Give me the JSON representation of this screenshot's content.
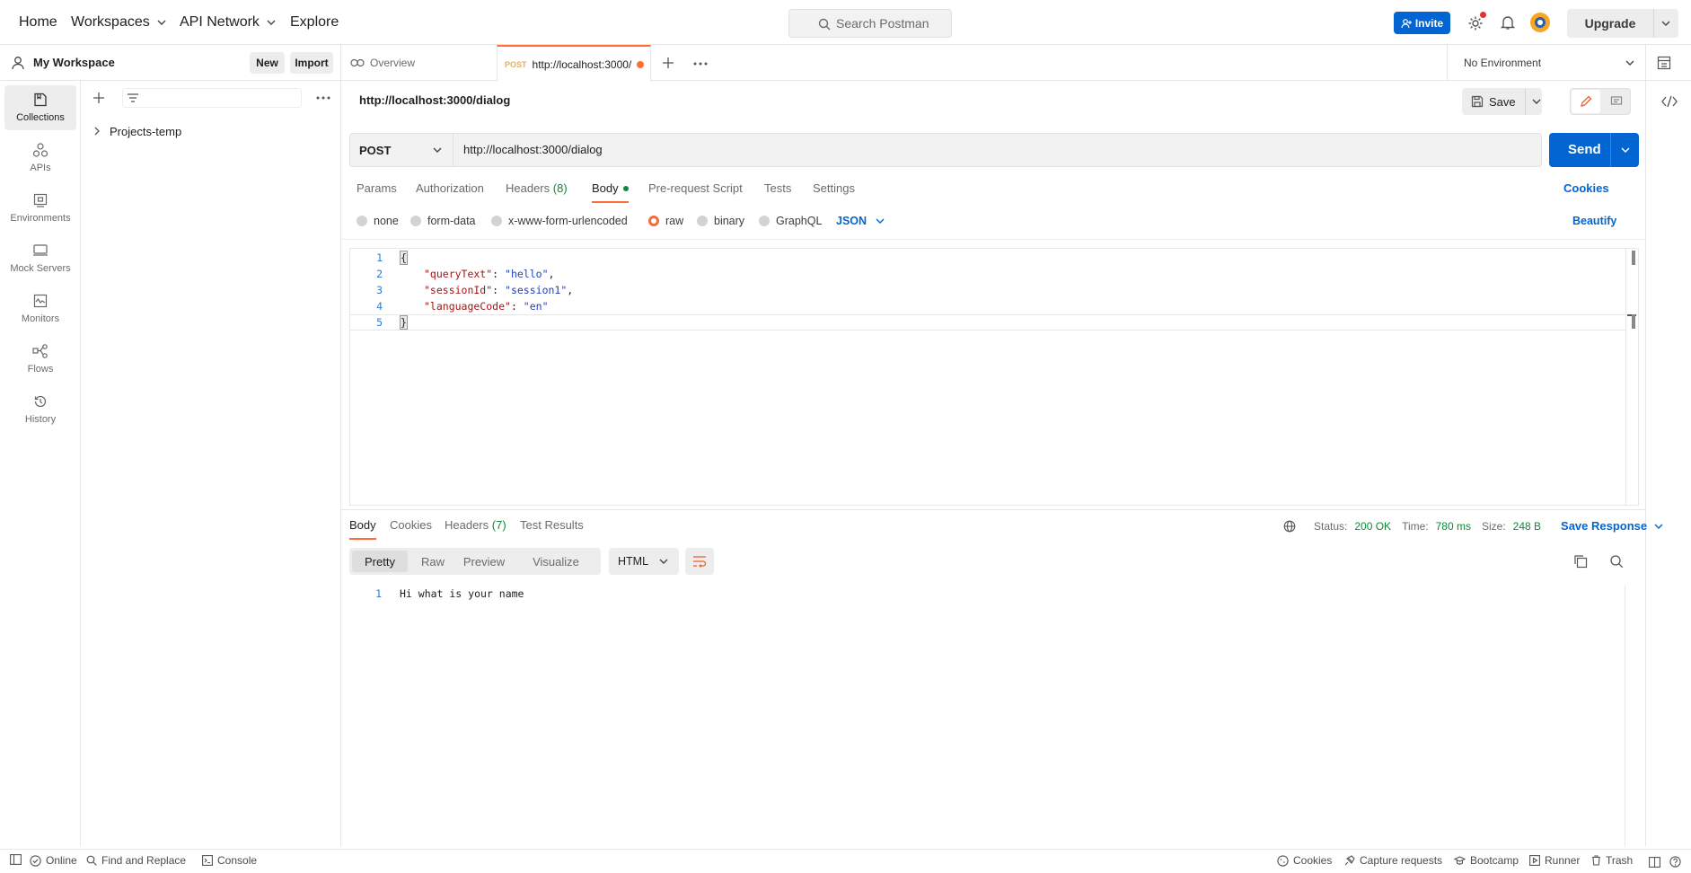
{
  "topbar": {
    "nav": [
      "Home",
      "Workspaces",
      "API Network",
      "Explore"
    ],
    "search_placeholder": "Search Postman",
    "invite_label": "Invite",
    "upgrade_label": "Upgrade"
  },
  "workspace": {
    "name": "My Workspace",
    "new_label": "New",
    "import_label": "Import"
  },
  "rail": [
    {
      "label": "Collections",
      "icon": "collections-icon"
    },
    {
      "label": "APIs",
      "icon": "apis-icon"
    },
    {
      "label": "Environments",
      "icon": "environments-icon"
    },
    {
      "label": "Mock Servers",
      "icon": "mock-servers-icon"
    },
    {
      "label": "Monitors",
      "icon": "monitors-icon"
    },
    {
      "label": "Flows",
      "icon": "flows-icon"
    },
    {
      "label": "History",
      "icon": "history-icon"
    }
  ],
  "sidebar": {
    "collections": [
      {
        "name": "Projects-temp"
      }
    ]
  },
  "tabs": {
    "overview_label": "Overview",
    "active_method": "POST",
    "active_url": "http://localhost:3000/",
    "environment": "No Environment"
  },
  "request": {
    "title": "http://localhost:3000/dialog",
    "save_label": "Save",
    "method": "POST",
    "url": "http://localhost:3000/dialog",
    "send_label": "Send",
    "subtabs": {
      "params": "Params",
      "authorization": "Authorization",
      "headers": "Headers",
      "headers_count": "(8)",
      "body": "Body",
      "prerequest": "Pre-request Script",
      "tests": "Tests",
      "settings": "Settings"
    },
    "cookies_label": "Cookies",
    "body_types": [
      "none",
      "form-data",
      "x-www-form-urlencoded",
      "raw",
      "binary",
      "GraphQL"
    ],
    "selected_body_type": "raw",
    "format": "JSON",
    "beautify_label": "Beautify",
    "code_lines": [
      {
        "n": "1",
        "text": "{"
      },
      {
        "n": "2",
        "key": "\"queryText\"",
        "val": "\"hello\"",
        "comma": ","
      },
      {
        "n": "3",
        "key": "\"sessionId\"",
        "val": "\"session1\"",
        "comma": ","
      },
      {
        "n": "4",
        "key": "\"languageCode\"",
        "val": "\"en\"",
        "comma": ""
      },
      {
        "n": "5",
        "text": "}"
      }
    ]
  },
  "response": {
    "tabs": {
      "body": "Body",
      "cookies": "Cookies",
      "headers": "Headers",
      "headers_count": "(7)",
      "test_results": "Test Results"
    },
    "status_label": "Status:",
    "status_value": "200 OK",
    "time_label": "Time:",
    "time_value": "780 ms",
    "size_label": "Size:",
    "size_value": "248 B",
    "save_response_label": "Save Response",
    "views": [
      "Pretty",
      "Raw",
      "Preview",
      "Visualize"
    ],
    "format": "HTML",
    "lines": [
      {
        "n": "1",
        "text": "Hi what is your name"
      }
    ]
  },
  "footer": {
    "online": "Online",
    "find_replace": "Find and Replace",
    "console": "Console",
    "cookies": "Cookies",
    "capture": "Capture requests",
    "bootcamp": "Bootcamp",
    "runner": "Runner",
    "trash": "Trash"
  },
  "colors": {
    "accent": "#ff6c37",
    "primary": "#0265d2",
    "success": "#0f8a3a"
  }
}
